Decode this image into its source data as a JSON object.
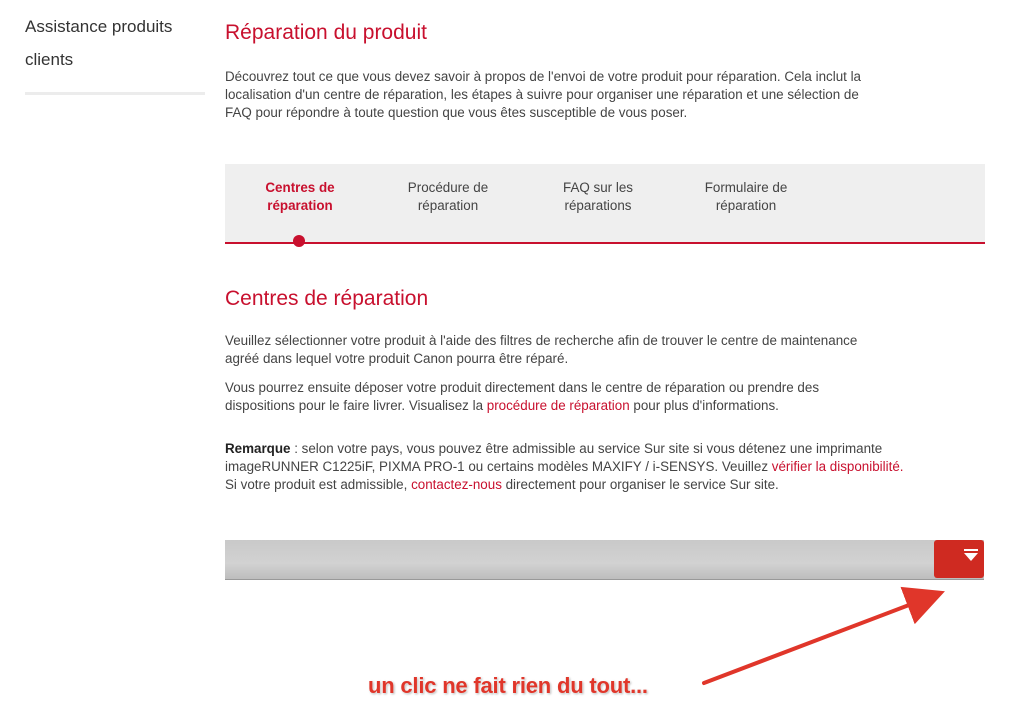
{
  "sidebar": {
    "link_line1": "Assistance produits",
    "link_line2": "clients"
  },
  "header": {
    "title": "Réparation du produit",
    "intro_line1": "Découvrez tout ce que vous devez savoir à propos de l'envoi de votre produit pour réparation. Cela inclut la",
    "intro_line2": "localisation d'un centre de réparation, les étapes à suivre pour organiser une réparation et une sélection de",
    "intro_line3": "FAQ pour répondre à toute question que vous êtes susceptible de vous poser."
  },
  "tabs": [
    {
      "line1": "Centres de",
      "line2": "réparation",
      "active": true
    },
    {
      "line1": "Procédure de",
      "line2": "réparation",
      "active": false
    },
    {
      "line1": "FAQ sur les",
      "line2": "réparations",
      "active": false
    },
    {
      "line1": "Formulaire de",
      "line2": "réparation",
      "active": false
    }
  ],
  "section": {
    "title": "Centres de réparation",
    "p1_line1": "Veuillez sélectionner votre produit à l'aide des filtres de recherche afin de trouver le centre de maintenance",
    "p1_line2": "agréé dans lequel votre produit Canon pourra être réparé.",
    "p2_line1": "Vous pourrez ensuite déposer votre produit directement dans le centre de réparation ou prendre des",
    "p2_line2_pre": "dispositions pour le faire livrer. Visualisez la ",
    "p2_link": "procédure de réparation",
    "p2_line2_post": " pour plus d'informations.",
    "note_label": "Remarque",
    "note_line1": " : selon votre pays, vous pouvez être admissible au service Sur site si vous détenez une imprimante",
    "note_line2_pre": "imageRUNNER C1225iF, PIXMA PRO-1 ou certains modèles MAXIFY / i-SENSYS. Veuillez ",
    "note_link1": "vérifier la disponibilité.",
    "note_line3_pre": "Si votre produit est admissible, ",
    "note_link2": "contactez-nous",
    "note_line3_post": " directement pour organiser le service Sur site."
  },
  "filter": {
    "icon": "filter-dropdown-icon"
  },
  "annotation": {
    "text": "un clic ne fait rien du tout...",
    "color": "#e0362a"
  },
  "colors": {
    "accent": "#c8102e",
    "tab_bar_bg": "#efefef",
    "button": "#cf2a21"
  }
}
